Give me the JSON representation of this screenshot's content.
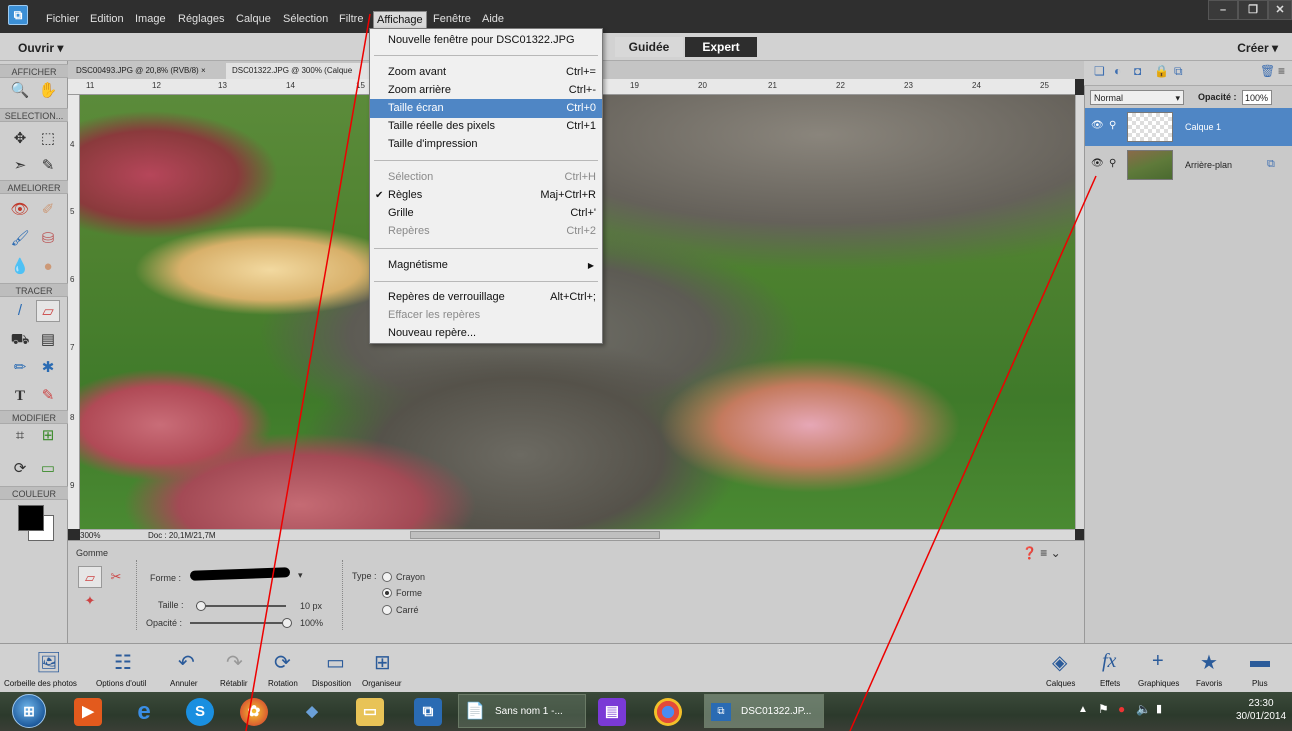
{
  "menubar": {
    "items": [
      "Fichier",
      "Edition",
      "Image",
      "Réglages",
      "Calque",
      "Sélection",
      "Filtre",
      "Affichage",
      "Fenêtre",
      "Aide"
    ],
    "active": "Affichage"
  },
  "window_controls": {
    "minimize": "–",
    "restore": "❐",
    "close": "✕"
  },
  "modebar": {
    "open": "Ouvrir",
    "open_arrow": "▾",
    "guided": "Guidée",
    "expert": "Expert",
    "create": "Créer",
    "create_arrow": "▾"
  },
  "toolbox": {
    "sections": [
      "AFFICHER",
      "SELECTION...",
      "AMELIORER",
      "TRACER",
      "MODIFIER",
      "COULEUR"
    ]
  },
  "doc_tabs": [
    {
      "label": "DSC00493.JPG @ 20,8% (RVB/8)",
      "close": "×"
    },
    {
      "label": "DSC01322.JPG @ 300% (Calque"
    }
  ],
  "ruler": {
    "top_ticks": [
      "11",
      "12",
      "13",
      "14",
      "15",
      "19",
      "20",
      "21",
      "22",
      "23",
      "24",
      "25"
    ],
    "left_ticks": [
      "4",
      "5",
      "6",
      "7",
      "8",
      "9"
    ]
  },
  "status": {
    "zoom": "300%",
    "doc": "Doc : 20,1M/21,7M"
  },
  "tool_options": {
    "tool_name": "Gomme",
    "forme_label": "Forme :",
    "taille_label": "Taille :",
    "taille_value": "10 px",
    "opacite_label": "Opacité :",
    "opacite_value": "100%",
    "type_label": "Type :",
    "types": [
      "Crayon",
      "Forme",
      "Carré"
    ],
    "selected_type": "Forme",
    "taille_fraction": 0.0,
    "opacite_fraction": 1.0
  },
  "layers": {
    "blend_mode": "Normal",
    "opacity_label": "Opacité :",
    "opacity_value": "100%",
    "items": [
      {
        "name": "Calque 1",
        "selected": true
      },
      {
        "name": "Arrière-plan",
        "selected": false
      }
    ]
  },
  "view_menu": {
    "items": [
      {
        "label": "Nouvelle fenêtre pour DSC01322.JPG",
        "shortcut": ""
      },
      {
        "label": "Zoom avant",
        "shortcut": "Ctrl+="
      },
      {
        "label": "Zoom arrière",
        "shortcut": "Ctrl+-"
      },
      {
        "label": "Taille écran",
        "shortcut": "Ctrl+0"
      },
      {
        "label": "Taille réelle des pixels",
        "shortcut": "Ctrl+1"
      },
      {
        "label": "Taille d'impression",
        "shortcut": ""
      },
      {
        "label": "Sélection",
        "shortcut": "Ctrl+H"
      },
      {
        "label": "Règles",
        "shortcut": "Maj+Ctrl+R"
      },
      {
        "label": "Grille",
        "shortcut": "Ctrl+'"
      },
      {
        "label": "Repères",
        "shortcut": "Ctrl+2"
      },
      {
        "label": "Magnétisme",
        "shortcut": ""
      },
      {
        "label": "Repères de verrouillage",
        "shortcut": "Alt+Ctrl+;"
      },
      {
        "label": "Effacer les repères",
        "shortcut": ""
      },
      {
        "label": "Nouveau repère...",
        "shortcut": ""
      }
    ]
  },
  "bottom_bar": {
    "left": [
      "Corbeille des photos",
      "Options d'outil",
      "Annuler",
      "Rétablir",
      "Rotation",
      "Disposition",
      "Organiseur"
    ],
    "right": [
      "Calques",
      "Effets",
      "Graphiques",
      "Favoris",
      "Plus"
    ]
  },
  "taskbar": {
    "tasks": [
      "Sans nom 1 -...",
      "DSC01322.JP..."
    ],
    "time": "23:30",
    "date": "30/01/2014"
  },
  "colors": {
    "accent": "#4f86c5",
    "dark": "#2d2d2d"
  }
}
